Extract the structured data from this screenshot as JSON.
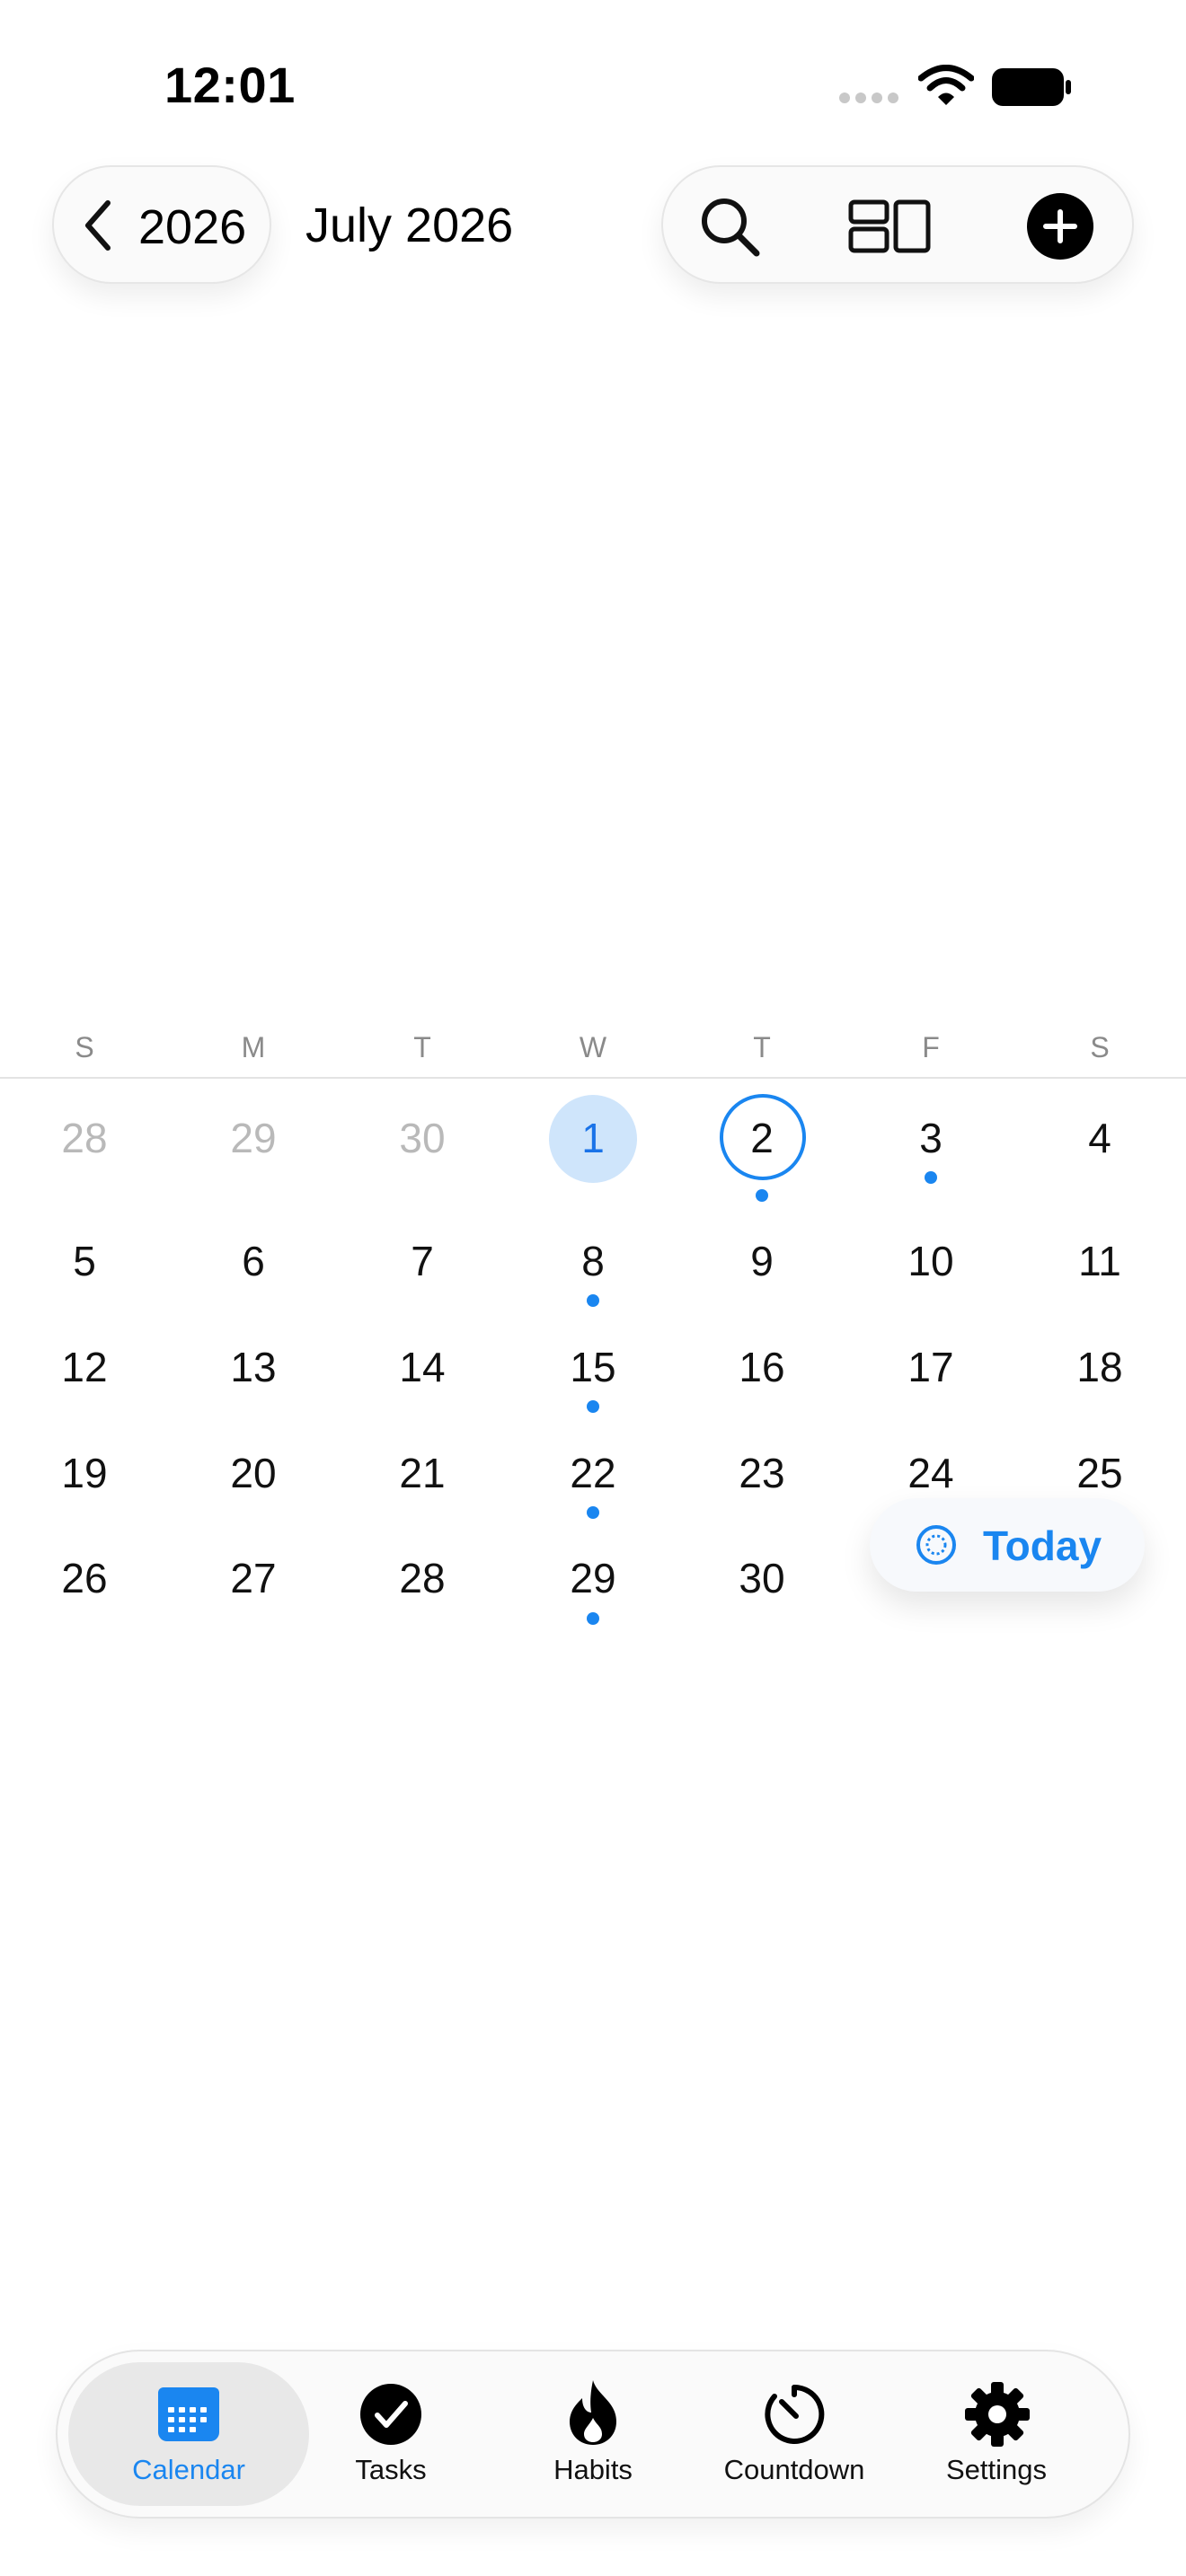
{
  "status_bar": {
    "time": "12:01"
  },
  "header": {
    "back_label": "2026",
    "title": "July 2026"
  },
  "weekdays": [
    "S",
    "M",
    "T",
    "W",
    "T",
    "F",
    "S"
  ],
  "calendar": {
    "rows": [
      [
        "28",
        "29",
        "30",
        "1",
        "2",
        "3",
        "4"
      ],
      [
        "5",
        "6",
        "7",
        "8",
        "9",
        "10",
        "11"
      ],
      [
        "12",
        "13",
        "14",
        "15",
        "16",
        "17",
        "18"
      ],
      [
        "19",
        "20",
        "21",
        "22",
        "23",
        "24",
        "25"
      ],
      [
        "26",
        "27",
        "28",
        "29",
        "30"
      ]
    ],
    "selected_day": "1",
    "today_day": "2",
    "days_with_events": [
      "2",
      "3",
      "8",
      "15",
      "22",
      "29"
    ]
  },
  "today_button": {
    "label": "Today"
  },
  "tabs": [
    {
      "label": "Calendar",
      "icon": "calendar-icon",
      "active": true
    },
    {
      "label": "Tasks",
      "icon": "checkmark-circle-icon",
      "active": false
    },
    {
      "label": "Habits",
      "icon": "flame-icon",
      "active": false
    },
    {
      "label": "Countdown",
      "icon": "timer-icon",
      "active": false
    },
    {
      "label": "Settings",
      "icon": "gear-icon",
      "active": false
    }
  ],
  "colors": {
    "accent": "#1a86f0",
    "selected_bg": "#cfe5fb",
    "muted_text": "#b9b9b9"
  }
}
